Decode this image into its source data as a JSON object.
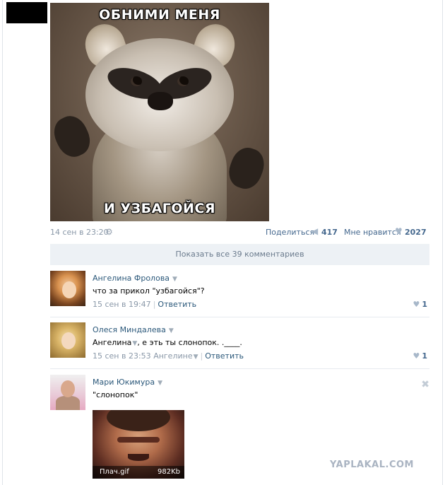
{
  "post": {
    "meme_caption_top": "ОБНИМИ МЕНЯ",
    "meme_caption_bottom": "И УЗБАГОЙСЯ",
    "date": "14 сен в 23:20",
    "share_label": "Поделиться",
    "share_count": "417",
    "like_label": "Мне нравится",
    "like_count": "2027"
  },
  "comments_bar": {
    "show_all_label": "Показать все 39 комментариев"
  },
  "comments": [
    {
      "author": "Ангелина Фролова",
      "text": "что за прикол \"узбагойся\"?",
      "time": "15 сен в 19:47",
      "reply_label": "Ответить",
      "likes": "1"
    },
    {
      "author": "Олеся Миндалева",
      "text_mention": "Ангелина",
      "text_rest": ", е  эть ты слонопок. .____.",
      "time": "15 сен в 23:53",
      "reply_to": "Ангелине",
      "reply_label": "Ответить",
      "likes": "1"
    },
    {
      "author": "Мари Юкимура",
      "text": "\"слонопок\"",
      "attachment_name": "Плач.gif",
      "attachment_size": "982Kb"
    }
  ],
  "watermark": "YAPLAKAL.COM",
  "icons": {
    "caret": "▼",
    "gear": "⚙",
    "share": "📢",
    "heart": "♥",
    "close": "✖"
  }
}
